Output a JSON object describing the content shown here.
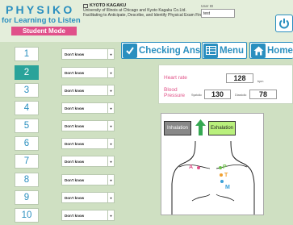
{
  "header": {
    "logo_title": "PHYSIKO",
    "logo_subtitle": "for Learning to Listen",
    "mode": "Student Mode",
    "org_name": "KYOTO KAGAKU",
    "org_line1": "University of Illinois at Chicago and Kyoto Kagaku Co.Ltd.",
    "org_line2": "Facilitating to Anticipate, Describe, and Identify Physical Exam Findings",
    "user_id_label": "User ID",
    "user_id_value": "test"
  },
  "questions": [
    {
      "number": "1",
      "answer": "Don't know",
      "active": false
    },
    {
      "number": "2",
      "answer": "Don't know",
      "active": true
    },
    {
      "number": "3",
      "answer": "Don't know",
      "active": false
    },
    {
      "number": "4",
      "answer": "Don't know",
      "active": false
    },
    {
      "number": "5",
      "answer": "Don't know",
      "active": false
    },
    {
      "number": "6",
      "answer": "Don't know",
      "active": false
    },
    {
      "number": "7",
      "answer": "Don't know",
      "active": false
    },
    {
      "number": "8",
      "answer": "Don't know",
      "active": false
    },
    {
      "number": "9",
      "answer": "Don't know",
      "active": false
    },
    {
      "number": "10",
      "answer": "Don't know",
      "active": false
    }
  ],
  "toolbar": {
    "check_label": "Checking Answers",
    "menu_label": "Menu",
    "home_label": "Home"
  },
  "vitals": {
    "heart_rate_label": "Heart rate",
    "heart_rate_value": "128",
    "heart_rate_unit": "bpm",
    "bp_label_1": "Blood",
    "bp_label_2": "Pressure",
    "systolic_label": "Systolic",
    "systolic_value": "130",
    "diastolic_label": "Diastolic",
    "diastolic_value": "78"
  },
  "auscultation": {
    "inhalation_label": "Inhalation",
    "exhalation_label": "Exhalation",
    "points": [
      "A",
      "P",
      "T",
      "M"
    ]
  },
  "colors": {
    "accent": "#2a8fbf",
    "pink": "#e0508a",
    "active_teal": "#2aa39a",
    "background": "#cfe0c2",
    "exhale_green": "#b9f07c"
  }
}
